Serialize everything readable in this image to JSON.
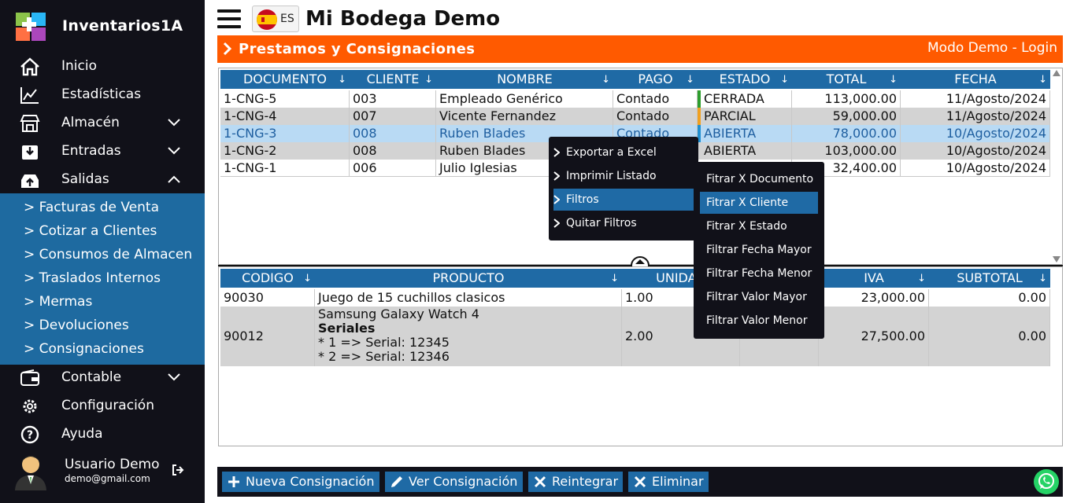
{
  "sidebar": {
    "brand": "Inventarios1A",
    "items": [
      {
        "label": "Inicio"
      },
      {
        "label": "Estadísticas"
      },
      {
        "label": "Almacén"
      },
      {
        "label": "Entradas"
      },
      {
        "label": "Salidas"
      }
    ],
    "submenu": [
      {
        "label": "> Facturas de Venta"
      },
      {
        "label": "> Cotizar a Clientes"
      },
      {
        "label": "> Consumos de Almacen"
      },
      {
        "label": "> Traslados Internos"
      },
      {
        "label": "> Mermas"
      },
      {
        "label": "> Devoluciones"
      },
      {
        "label": "> Consignaciones"
      }
    ],
    "items_after": [
      {
        "label": "Contable"
      },
      {
        "label": "Configuración"
      },
      {
        "label": "Ayuda"
      }
    ],
    "user": {
      "name": "Usuario Demo",
      "email": "demo@gmail.com"
    }
  },
  "header": {
    "lang": "ES",
    "title": "Mi Bodega Demo",
    "section_title": "Prestamos y Consignaciones",
    "demo_link": "Modo Demo - Login"
  },
  "top_grid": {
    "columns": [
      "DOCUMENTO",
      "CLIENTE",
      "NOMBRE",
      "PAGO",
      "ESTADO",
      "TOTAL",
      "FECHA"
    ],
    "sort_arrow": "↓",
    "rows": [
      {
        "doc": "1-CNG-5",
        "cliente": "003",
        "nombre": "Empleado Genérico",
        "pago": "Contado",
        "estado": "CERRADA",
        "total": "113,000.00",
        "fecha": "11/Agosto/2024",
        "estado_color": "#2e9e2e"
      },
      {
        "doc": "1-CNG-4",
        "cliente": "007",
        "nombre": "Vicente Fernandez",
        "pago": "Contado",
        "estado": "PARCIAL",
        "total": "59,000.00",
        "fecha": "11/Agosto/2024",
        "estado_color": "#f0a020"
      },
      {
        "doc": "1-CNG-3",
        "cliente": "008",
        "nombre": "Ruben Blades",
        "pago": "Contado",
        "estado": "ABIERTA",
        "total": "78,000.00",
        "fecha": "10/Agosto/2024",
        "estado_color": "#1f8fd0"
      },
      {
        "doc": "1-CNG-2",
        "cliente": "008",
        "nombre": "Ruben Blades",
        "pago": "",
        "estado": "ABIERTA",
        "total": "103,000.00",
        "fecha": "10/Agosto/2024",
        "estado_color": ""
      },
      {
        "doc": "1-CNG-1",
        "cliente": "006",
        "nombre": "Julio Iglesias",
        "pago": "",
        "estado": "",
        "total": "32,400.00",
        "fecha": "10/Agosto/2024",
        "estado_color": ""
      }
    ]
  },
  "bottom_grid": {
    "columns": [
      "CODIGO",
      "PRODUCTO",
      "UNIDAD",
      "",
      "IVA",
      "SUBTOTAL"
    ],
    "rows": [
      {
        "codigo": "90030",
        "producto": "Juego de 15 cuchillos clasicos",
        "unidad": "1.00",
        "iva": "23,000.00",
        "subtotal": "0.00"
      },
      {
        "codigo": "90012",
        "producto": "Samsung Galaxy Watch 4",
        "seriales_title": "Seriales",
        "serial1": "* 1 => Serial: 12345",
        "serial2": "* 2 => Serial: 12346",
        "unidad": "2.00",
        "iva": "27,500.00",
        "subtotal": "0.00"
      }
    ]
  },
  "context_menu": {
    "items": [
      "Exportar a Excel",
      "Imprimir Listado",
      "Filtros",
      "Quitar Filtros"
    ],
    "filters": [
      "Fitrar X Documento",
      "Fitrar X Cliente",
      "Fitrar X Estado",
      "Filtrar Fecha Mayor",
      "Filtrar Fecha Menor",
      "Filtrar Valor Mayor",
      "Filtrar Valor Menor"
    ]
  },
  "toolbar": {
    "buttons": [
      "Nueva Consignación",
      "Ver Consignación",
      "Reintegrar",
      "Eliminar"
    ]
  },
  "colors": {
    "accent": "#1f6aa5",
    "header_orange": "#ff5a00",
    "dark": "#111119"
  }
}
